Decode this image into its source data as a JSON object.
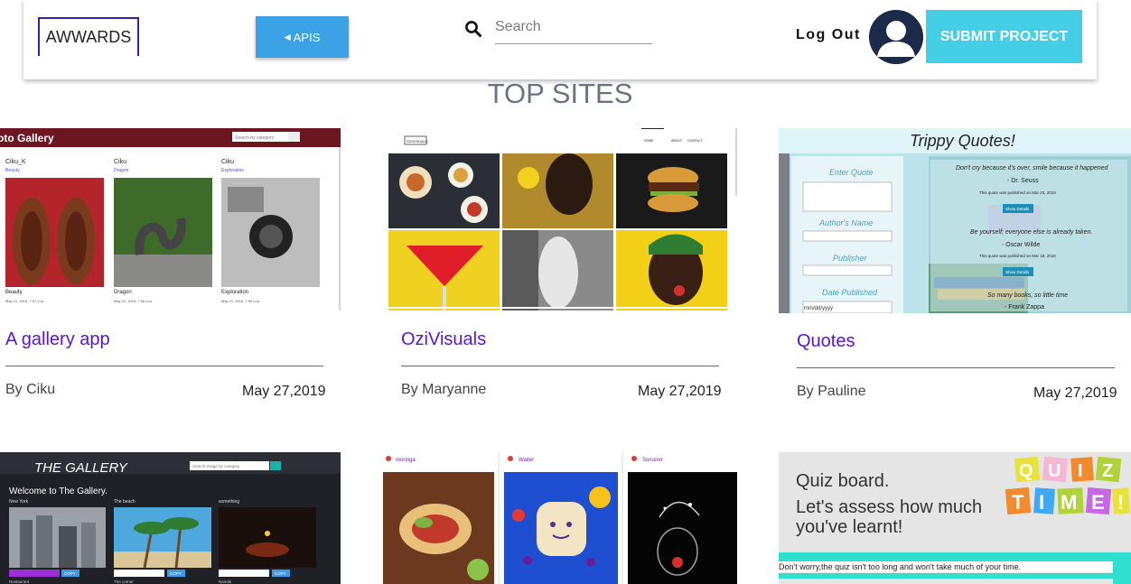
{
  "navbar": {
    "brand": "AWWARDS",
    "apis_label": "APIS",
    "search_placeholder": "Search",
    "logout_label": "Log Out",
    "submit_label": "SUBMIT PROJECT"
  },
  "section_title": "TOP SITES",
  "projects": [
    {
      "title": "A gallery app",
      "author": "By Ciku",
      "date": "May 27,2019",
      "thumb": {
        "header": "oto Gallery",
        "search": "Search by category",
        "items": [
          {
            "name": "Ciku_K",
            "link": "Beauty",
            "caption": "Beauty",
            "date": "May 21, 2019, 7:57 a.m."
          },
          {
            "name": "Ciku",
            "link": "Dragon",
            "caption": "Dragon",
            "date": "May 21, 2019, 7:58 a.m."
          },
          {
            "name": "Ciku",
            "link": "Exploration",
            "caption": "Exploration",
            "date": "May 21, 2019, 7:59 a.m."
          }
        ]
      }
    },
    {
      "title": "OziVisuals",
      "author": "By Maryanne",
      "date": "May 27,2019",
      "thumb": {
        "logo": "OZIVISUALS",
        "nav": [
          "HOME",
          "ABOUT",
          "CONTACT"
        ]
      }
    },
    {
      "title": "Quotes",
      "author": "By Pauline",
      "date": "May 27,2019",
      "thumb": {
        "heading": "Trippy Quotes!",
        "form_labels": [
          "Enter Quote",
          "Author's Name",
          "Publisher",
          "Date Published"
        ],
        "date_placeholder": "mm/dd/yyyy",
        "quotes": [
          {
            "text": "Don't cry because it's over, smile because it happened",
            "author": "- Dr. Seuss",
            "meta": "This quote was published on Mar 20, 2019",
            "btn": "Show Details"
          },
          {
            "text": "Be yourself; everyone else is already taken.",
            "author": "- Oscar Wilde",
            "meta": "This quote was published on Mar 18, 2019",
            "btn": "Show Details"
          },
          {
            "text": "So many books, so little time",
            "author": "- Frank Zappa"
          }
        ]
      }
    },
    {
      "title": "",
      "author": "",
      "date": "",
      "thumb": {
        "header": "THE GALLERY",
        "search": "Search image by category",
        "welcome": "Welcome to The Gallery.",
        "labels": [
          "New York",
          "The beach",
          "something"
        ],
        "copy": "COPY",
        "footer": [
          "Restaurant",
          "The corner",
          "Nairobi"
        ]
      }
    },
    {
      "title": "",
      "author": "",
      "date": "",
      "thumb": {
        "users": [
          "moringa",
          "Waiter",
          "Sorcerer"
        ]
      }
    },
    {
      "title": "",
      "author": "",
      "date": "",
      "thumb": {
        "heading": "Quiz board.",
        "sub": "Let's assess how much you've learnt!",
        "quiz_letters": [
          "Q",
          "U",
          "I",
          "Z",
          "T",
          "I",
          "M",
          "E",
          "!"
        ],
        "note": "Don't worry,the quiz isn't too long and won't take much of your time."
      }
    }
  ],
  "colors": {
    "accent_button": "#3ca2e6",
    "submit_button": "#44cfe6",
    "title_purple": "#5a14d6",
    "rule_teal": "#1b83a8",
    "brand_border": "#3b1fa8"
  }
}
